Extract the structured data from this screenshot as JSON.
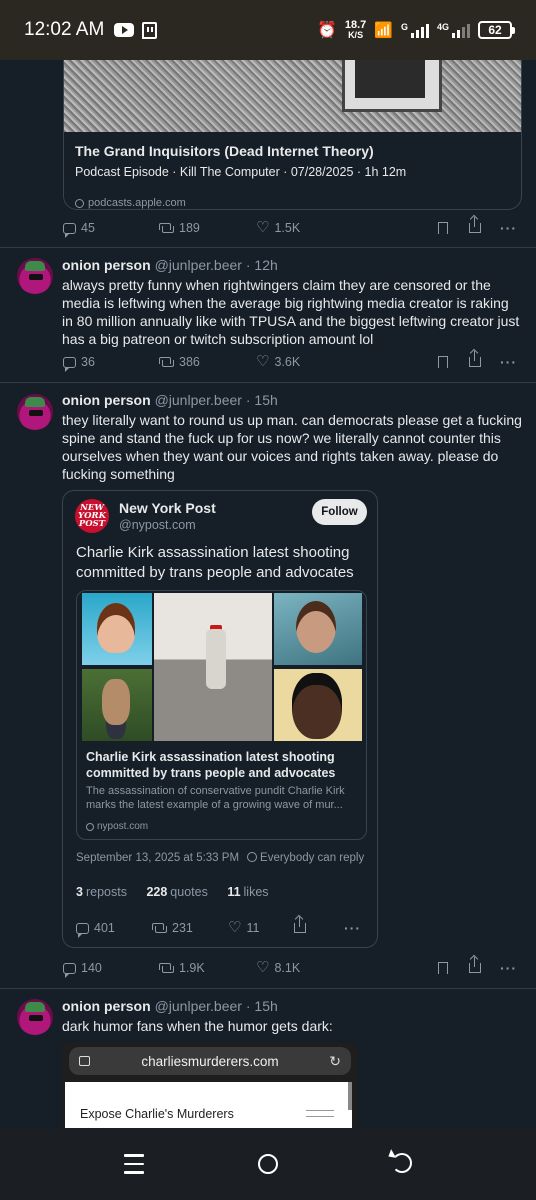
{
  "status_bar": {
    "time": "12:02 AM",
    "net_speed_value": "18.7",
    "net_speed_unit": "K/S",
    "sim1": "G",
    "sim2": "4G",
    "battery": "62"
  },
  "top_card": {
    "title": "The Grand Inquisitors (Dead Internet Theory)",
    "meta": "Podcast Episode · Kill The Computer · 07/28/2025 · 1h 12m",
    "domain": "podcasts.apple.com",
    "actions": {
      "replies": "45",
      "reposts": "189",
      "likes": "1.5K"
    }
  },
  "posts": [
    {
      "name": "onion person",
      "handle": "@junlper.beer",
      "time": "12h",
      "text": "always pretty funny when rightwingers claim they are censored or the media is leftwing when the average big rightwing media creator is raking in 80 million annually like with TPUSA and the biggest leftwing creator just has a big patreon or twitch subscription amount lol",
      "actions": {
        "replies": "36",
        "reposts": "386",
        "likes": "3.6K"
      }
    },
    {
      "name": "onion person",
      "handle": "@junlper.beer",
      "time": "15h",
      "text": "they literally want to round us up man.  can democrats please get a fucking spine and stand the fuck up for us now?  we literally cannot counter this ourselves when they want our voices and rights taken away. please do fucking something",
      "actions": {
        "replies": "140",
        "reposts": "1.9K",
        "likes": "8.1K"
      }
    },
    {
      "name": "onion person",
      "handle": "@junlper.beer",
      "time": "15h",
      "text": "dark humor fans when the humor gets dark:"
    }
  ],
  "quote": {
    "logo_text": [
      "NEW",
      "YORK",
      "POST"
    ],
    "name": "New York Post",
    "handle": "@nypost.com",
    "follow": "Follow",
    "text": "Charlie Kirk assassination latest shooting committed by trans people and advocates",
    "link_title": "Charlie Kirk assassination latest shooting committed by trans people and advocates",
    "link_desc": "The assassination of conservative pundit Charlie Kirk marks the latest example of a growing wave of mur...",
    "link_domain": "nypost.com",
    "date": "September 13, 2025 at 5:33 PM",
    "reply_setting": "Everybody can reply",
    "stats": {
      "reposts_n": "3",
      "reposts_l": "reposts",
      "quotes_n": "228",
      "quotes_l": "quotes",
      "likes_n": "11",
      "likes_l": "likes"
    },
    "actions": {
      "replies": "401",
      "reposts": "231",
      "likes": "11"
    }
  },
  "embedded_browser": {
    "url": "charliesmurderers.com",
    "heading": "Expose Charlie's Murderers"
  },
  "icons": [
    "youtube-icon",
    "twitch-icon",
    "alarm-icon",
    "wifi-icon",
    "signal-icon",
    "battery-icon",
    "reply-icon",
    "repost-icon",
    "heart-icon",
    "bookmark-icon",
    "share-icon",
    "more-icon",
    "globe-icon",
    "menu-icon",
    "home-icon",
    "back-icon"
  ],
  "colors": {
    "background": "#161e27",
    "text": "#e7e9ea",
    "muted": "#8b98a5",
    "border": "#38444d",
    "nypost_red": "#c8102e"
  }
}
